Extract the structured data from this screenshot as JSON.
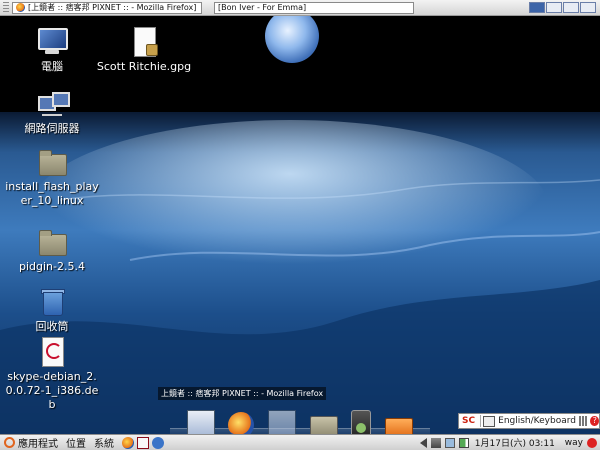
{
  "top_panel": {
    "tasks": [
      {
        "label": "[上鏡者 :: 痞客邦 PIXNET :: - Mozilla Firefox]"
      },
      {
        "label": "[Bon Iver - For Emma]"
      }
    ]
  },
  "desktop": {
    "icons": [
      {
        "label": "電腦",
        "icon": "computer-icon"
      },
      {
        "label": "Scott Ritchie.gpg",
        "icon": "locked-file-icon"
      },
      {
        "label": "網路伺服器",
        "icon": "network-servers-icon"
      },
      {
        "label": "install_flash_player_10_linux",
        "icon": "folder-icon"
      },
      {
        "label": "pidgin-2.5.4",
        "icon": "folder-icon"
      },
      {
        "label": "回收筒",
        "icon": "trash-icon"
      },
      {
        "label": "skype-debian_2.0.0.72-1_i386.deb",
        "icon": "debian-package-icon"
      }
    ]
  },
  "dock": {
    "tooltip": "上鏡者 :: 痞客邦 PIXNET :: - Mozilla Firefox"
  },
  "ime": {
    "label": "English/Keyboard"
  },
  "bottom_panel": {
    "menus": [
      "應用程式",
      "位置",
      "系統"
    ],
    "date": "1月17日(六)",
    "time": "03:11",
    "user": "way"
  }
}
